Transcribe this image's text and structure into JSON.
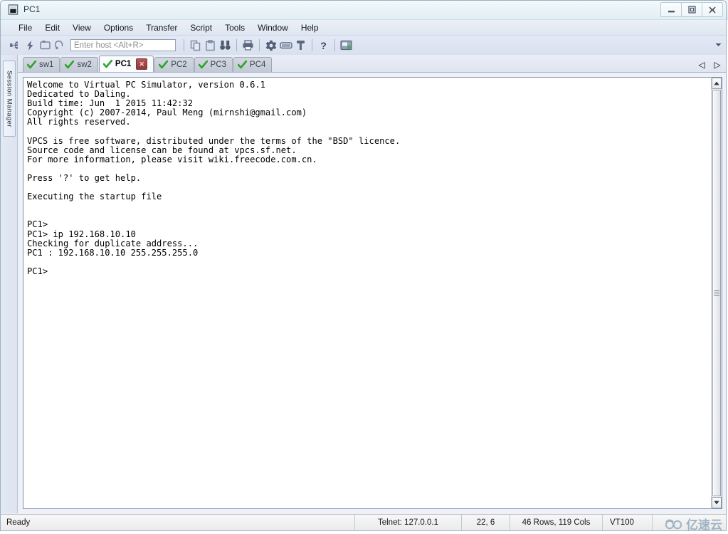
{
  "window": {
    "title": "PC1",
    "app_icon": "terminal-window-icon",
    "controls": [
      {
        "name": "minimize-button",
        "glyph": "minimize-icon"
      },
      {
        "name": "restore-button",
        "glyph": "restore-icon"
      },
      {
        "name": "close-button",
        "glyph": "close-icon"
      }
    ]
  },
  "menubar": {
    "items": [
      {
        "label": "File"
      },
      {
        "label": "Edit"
      },
      {
        "label": "View"
      },
      {
        "label": "Options"
      },
      {
        "label": "Transfer"
      },
      {
        "label": "Script"
      },
      {
        "label": "Tools"
      },
      {
        "label": "Window"
      },
      {
        "label": "Help"
      }
    ]
  },
  "toolbar": {
    "host_placeholder": "Enter host <Alt+R>",
    "host_value": "",
    "buttons": [
      {
        "name": "connect-icon"
      },
      {
        "name": "quick-connect-icon"
      },
      {
        "name": "connect-in-tab-icon"
      },
      {
        "name": "reconnect-icon"
      },
      {
        "name": "copy-icon"
      },
      {
        "name": "paste-icon"
      },
      {
        "name": "find-icon"
      },
      {
        "name": "print-icon"
      },
      {
        "name": "settings-icon"
      },
      {
        "name": "keyboard-icon"
      },
      {
        "name": "key-icon"
      },
      {
        "name": "help-icon"
      },
      {
        "name": "session-manager-icon"
      }
    ],
    "overflow_icon": "chevron-down-icon"
  },
  "sidebar": {
    "session_manager_label": "Session Manager"
  },
  "tabs": {
    "items": [
      {
        "label": "sw1",
        "active": false,
        "status": "connected"
      },
      {
        "label": "sw2",
        "active": false,
        "status": "connected"
      },
      {
        "label": "PC1",
        "active": true,
        "status": "connected"
      },
      {
        "label": "PC2",
        "active": false,
        "status": "connected"
      },
      {
        "label": "PC3",
        "active": false,
        "status": "connected"
      },
      {
        "label": "PC4",
        "active": false,
        "status": "connected"
      }
    ],
    "close_glyph": "✕",
    "nav_prev": "◁",
    "nav_next": "▷"
  },
  "terminal": {
    "text": "Welcome to Virtual PC Simulator, version 0.6.1\nDedicated to Daling.\nBuild time: Jun  1 2015 11:42:32\nCopyright (c) 2007-2014, Paul Meng (mirnshi@gmail.com)\nAll rights reserved.\n\nVPCS is free software, distributed under the terms of the \"BSD\" licence.\nSource code and license can be found at vpcs.sf.net.\nFor more information, please visit wiki.freecode.com.cn.\n\nPress '?' to get help.\n\nExecuting the startup file\n\n\nPC1>\nPC1> ip 192.168.10.10\nChecking for duplicate address...\nPC1 : 192.168.10.10 255.255.255.0\n\nPC1>",
    "scrollbar": {
      "up_arrow": "▲",
      "down_arrow": "▼"
    }
  },
  "statusbar": {
    "ready": "Ready",
    "connection": "Telnet: 127.0.0.1",
    "cursor": "22,  6",
    "dimensions": "46 Rows, 119 Cols",
    "emulation": "VT100"
  },
  "watermark": {
    "text": "亿速云",
    "icon": "cloud-glasses-icon"
  },
  "colors": {
    "accent": "#4a7ab5",
    "tab_active_bg": "#fbfcfe",
    "tab_close_red": "#8f3a3a",
    "check_green": "#2fa32f",
    "toolbar_icon": "#66738c",
    "terminal_bg": "#ffffff",
    "terminal_fg": "#000000"
  }
}
